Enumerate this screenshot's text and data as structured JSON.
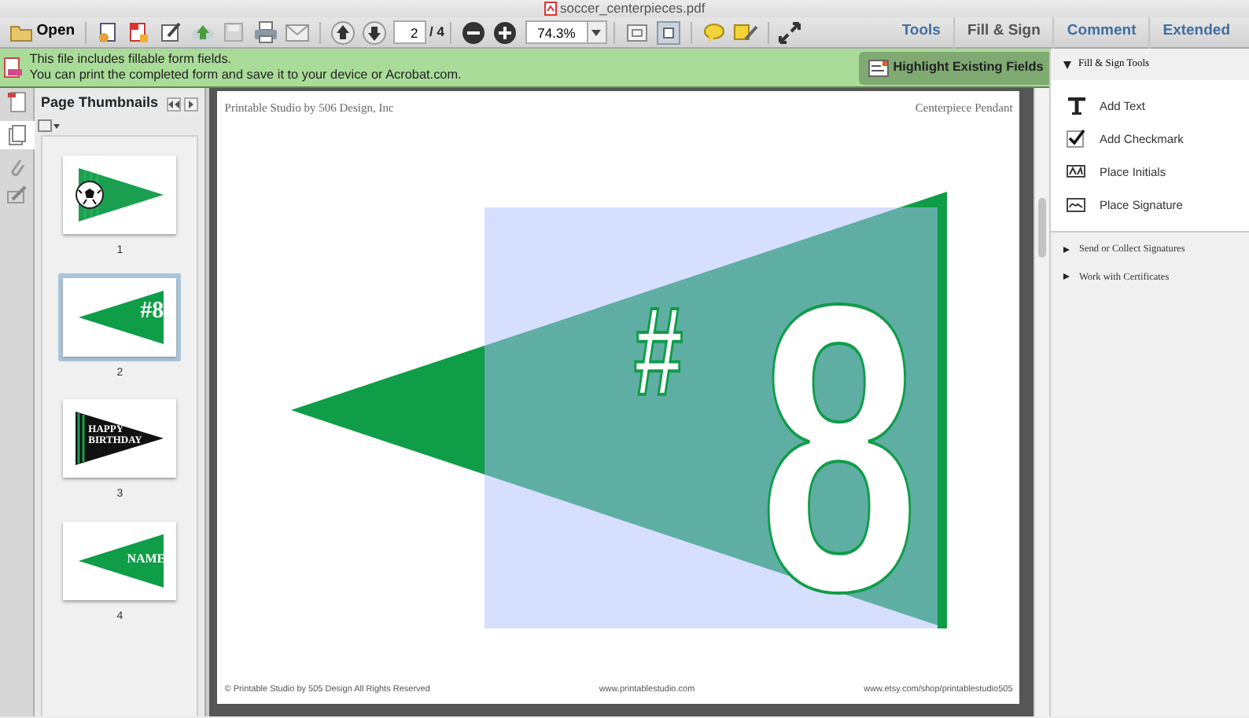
{
  "window": {
    "title": "soccer_centerpieces.pdf"
  },
  "toolbar": {
    "open": "Open",
    "page_current": "2",
    "page_total": "/ 4",
    "zoom": "74.3%"
  },
  "tabs": [
    {
      "label": "Tools",
      "selected": false
    },
    {
      "label": "Fill & Sign",
      "selected": true
    },
    {
      "label": "Comment",
      "selected": false
    },
    {
      "label": "Extended",
      "selected": false
    }
  ],
  "infobar": {
    "lines": [
      "This file includes fillable form fields.",
      "You can print the completed form and save it to your device or Acrobat.com."
    ],
    "button": "Highlight Existing Fields"
  },
  "thumbnails": {
    "title": "Page Thumbnails",
    "pages": [
      {
        "label": "1",
        "kind": "ball",
        "selected": false
      },
      {
        "label": "2",
        "kind": "number",
        "text_lines": [
          "#8"
        ],
        "selected": true
      },
      {
        "label": "3",
        "kind": "banner",
        "text_lines": [
          "HAPPY",
          "BIRTHDAY"
        ],
        "selected": false
      },
      {
        "label": "4",
        "kind": "name",
        "text_lines": [
          "NAME"
        ],
        "selected": false
      }
    ]
  },
  "document": {
    "header_left": "Printable Studio by 506 Design, Inc",
    "header_right": "Centerpiece Pendant",
    "number": "#8",
    "footer": [
      "© Printable Studio by 505 Design All Rights Reserved",
      "www.printablestudio.com",
      "www.etsy.com/shop/printablestudio505"
    ]
  },
  "fill_sign": {
    "title": "Fill & Sign Tools",
    "expanded": true,
    "tools": [
      {
        "kind": "text",
        "label": "Add Text"
      },
      {
        "kind": "check",
        "label": "Add Checkmark"
      },
      {
        "kind": "initials",
        "label": "Place Initials"
      },
      {
        "kind": "signature",
        "label": "Place Signature"
      }
    ],
    "sections": [
      {
        "label": "Send or Collect Signatures",
        "expanded": false
      },
      {
        "label": "Work with Certificates",
        "expanded": false
      }
    ]
  }
}
